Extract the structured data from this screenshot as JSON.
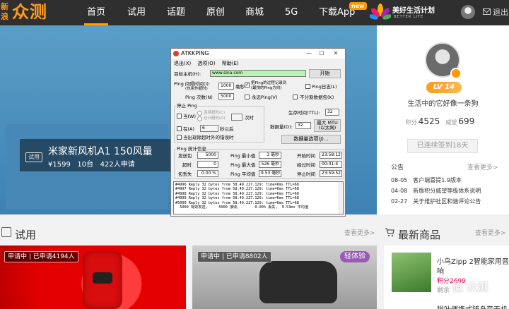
{
  "logo": {
    "small": "新浪",
    "main": "众测"
  },
  "nav": {
    "items": [
      "首页",
      "试用",
      "话题",
      "原创",
      "商城",
      "5G",
      "下载App"
    ],
    "new_badge": "new",
    "brand": "美好生活计划",
    "brand_sub": "BETTER LIFE",
    "logout": "退出"
  },
  "banner": {
    "badge": "试用",
    "title": "米家新风机A1 150风量",
    "price": "¥1599",
    "count": "10台",
    "applicants": "422人申请"
  },
  "user": {
    "level": "LV 14",
    "motto": "生活中的它好像一条狗",
    "points_label": "积分",
    "points": "4525",
    "prestige_label": "威望",
    "prestige": "699",
    "signed": "已连续签到18天"
  },
  "announcements": {
    "title": "公告",
    "more": "查看更多>",
    "items": [
      {
        "date": "08-05",
        "text": "客户端喜提1.9版本"
      },
      {
        "date": "04-08",
        "text": "新版积分威望等级体系说明"
      },
      {
        "date": "02-27",
        "text": "关于维护社区和谐评论公告"
      }
    ]
  },
  "trial": {
    "title": "试用",
    "more": "查看更多>",
    "cards": [
      {
        "tag": "申请中 | 已申请4194人"
      },
      {
        "tag": "申请中 | 已申请8802人",
        "badge": "轻体验"
      }
    ]
  },
  "newest": {
    "title": "最新商品",
    "more": "查看更多>",
    "item1_title": "小鸟Zipp 2智能家用音",
    "item1_sub": "响",
    "item1_points": "积分2699",
    "item1_left": "剩余",
    "item2_title": "猫叶便携式随身音无机"
  },
  "watermark": "值 众测",
  "dialog": {
    "title": "ATKKPING",
    "menu": [
      "退出(X)",
      "选项(O)",
      "帮助(E)"
    ],
    "host_label": "目标主机(H):",
    "host_value": "www.sina.com",
    "start_btn": "开始",
    "interval_label": "Ping 间隔时间(I):",
    "interval_sub": "(也用作超时)",
    "interval_value": "1000",
    "ms": "毫秒",
    "save_check_label": "把Ping的过程记录到",
    "save_check_sub": "(最快的Ping方向)",
    "log_check": "Ping日志(L)",
    "count_label": "Ping 次数(N)",
    "count_value": "5000",
    "forever": "永远Ping(V)",
    "no_split": "不分割数据包(K)",
    "stop_group": "停止 Ping",
    "when_label": "当(W)",
    "cont_timeout": "连续超时(C)",
    "total_timeout": "总计超时(O)",
    "times": "次时",
    "at_label": "在(A)",
    "at_value": "6",
    "sec_after": "秒以后",
    "on_timeout": "当出现除超时外的错误时",
    "ttl_label": "生存时间(TTL):",
    "ttl_value": "32",
    "data_label": "数据量(D):",
    "data_value": "32",
    "max_mtu": "最大 MTU",
    "max_mtu_sub": "(以太网)",
    "data_options": "数据量选项(J)...",
    "stats_group": "Ping 统计信息",
    "stats": [
      {
        "l1": "发送包",
        "v1": "5000",
        "l2": "Ping 最小值",
        "v2": "3 毫秒",
        "l3": "开始时间",
        "v3": "23:58:12"
      },
      {
        "l1": "超时",
        "v1": "0",
        "l2": "Ping 最大值",
        "v2": "526 毫秒",
        "l3": "经过时间",
        "v3": "00:01:4"
      },
      {
        "l1": "包丢失",
        "v1": "0.00 %",
        "l2": "Ping 平均值",
        "v2": "9.53 毫秒",
        "l3": "停止时间",
        "v3": "23:59:52"
      }
    ],
    "log_lines": [
      "#4996 Reply 32 bytes from 58.49.227.129: time=6ms TTL=68",
      "#4997 Reply 32 bytes from 58.49.227.129: time=6ms TTL=68",
      "#4998 Reply 32 bytes from 58.49.227.129: time=6ms TTL=68",
      "#4999 Reply 32 bytes from 58.49.227.129: time=6ms TTL=68",
      "#5000 Reply 32 bytes from 58.49.227.129: time=6ms TTL=68",
      "  5000 有效发送,     5000 接收,       0.00% 丢失,  9.53ms 平均值"
    ]
  },
  "colors": {
    "accent": "#ffa000",
    "nav_bg": "#2f2f2f",
    "ping_green": "#b7f5b2"
  }
}
